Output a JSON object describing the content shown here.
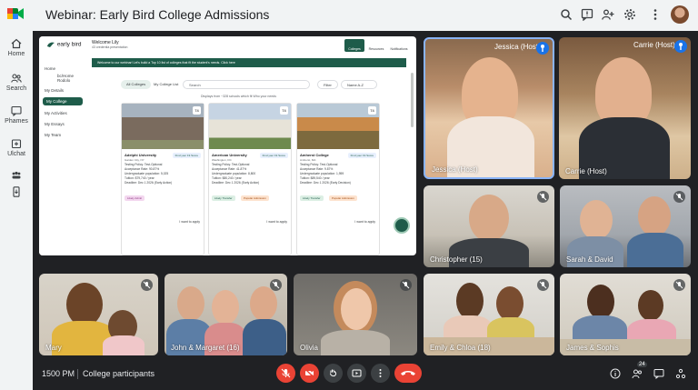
{
  "window": {
    "title": "Webinar: Early Bird College Admissions"
  },
  "rail": {
    "items": [
      {
        "label": "Home",
        "icon": "home-icon"
      },
      {
        "label": "Search",
        "icon": "people-icon"
      },
      {
        "label": "Phames",
        "icon": "chat-icon"
      },
      {
        "label": "Ulchat",
        "icon": "add-icon"
      },
      {
        "label": "",
        "icon": "group-icon"
      },
      {
        "label": "",
        "icon": "phone-icon"
      }
    ]
  },
  "shared_screen": {
    "app_name": "early bird",
    "welcome": "Welcome Lily",
    "welcome_sub": "43 credentia presentation",
    "nav": [
      "Home",
      "bc/Home Rodolo",
      "My Details",
      "My College",
      "My Activities",
      "My Essays",
      "My Team"
    ],
    "tabs": [
      "Colleges",
      "Resources",
      "Notifications"
    ],
    "banner": "Welcome to our webinar! Let's build a Top 10 list of colleges that fit the student's needs. Click here",
    "pills": [
      "All Colleges",
      "My College List"
    ],
    "filter_label": "Filter",
    "sort_label": "Name A-Z",
    "search_placeholder": "Search",
    "result_count": "Displays from ~328 schools which fit Who your needs",
    "cards": [
      {
        "name": "Adelphi University",
        "location": "Garden City, NY",
        "fit": "Find your Fit Score",
        "badge": "74",
        "stats": [
          "Testing Policy: Test-Optional",
          "Acceptance Rate: 90.87%",
          "Undergraduate population: 5,025",
          "Tuition: $79,740 / year",
          "Deadline: Dec 1 2026 (Early Action)"
        ],
        "tags": [
          "Likely Admit"
        ],
        "apply": "I want to apply"
      },
      {
        "name": "American University",
        "location": "Washington, DC",
        "fit": "Find your Fit Score",
        "badge": "74",
        "stats": [
          "Testing Policy: Test-Optional",
          "Acceptance Rate: 41.87%",
          "Undergraduate population: 8,800",
          "Tuition: $80,240 / year",
          "Deadline: Dec 1 2026 (Early Action)"
        ],
        "tags": [
          "Likely Transfer",
          "Popular Admission"
        ],
        "apply": "I want to apply"
      },
      {
        "name": "Amherst College",
        "location": "Amherst, MA",
        "fit": "Find your Fit Score",
        "badge": "74",
        "stats": [
          "Testing Policy: Test-Optional",
          "Acceptance Rate: 9.87%",
          "Undergraduate population: 1,959",
          "Tuition: $89,540 / year",
          "Deadline: Dec 1 2026 (Early Decision)"
        ],
        "tags": [
          "Likely Transfer",
          "Popular Admission"
        ],
        "apply": "I want to apply"
      }
    ]
  },
  "participants": [
    {
      "name": "Jessica (Host)",
      "tag": "Jessica (Host)"
    },
    {
      "name": "Carrie (Host)",
      "tag": "Carrie (Host)"
    },
    {
      "name": "Christopher (15)"
    },
    {
      "name": "Sarah & David"
    },
    {
      "name": "Mary"
    },
    {
      "name": "John & Margaret (16)"
    },
    {
      "name": "Olivia"
    },
    {
      "name": "Emily & Chloa (18)"
    },
    {
      "name": "James & Sophis"
    }
  ],
  "bottom": {
    "time": "1500 PM",
    "meeting": "College participants",
    "people_count": "24"
  },
  "colors": {
    "brand_green": "#1e5c4a",
    "end_red": "#ea4335",
    "pin_blue": "#1a73e8",
    "bg_dark": "#202124"
  }
}
